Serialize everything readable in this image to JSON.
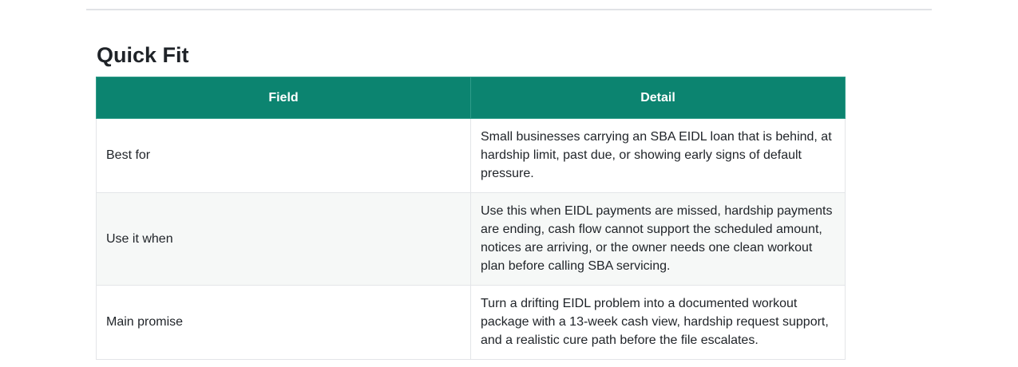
{
  "section": {
    "title": "Quick Fit"
  },
  "table": {
    "headers": [
      "Field",
      "Detail"
    ],
    "rows": [
      {
        "field": "Best for",
        "detail": "Small businesses carrying an SBA EIDL loan that is behind, at hardship limit, past due, or showing early signs of default pressure."
      },
      {
        "field": "Use it when",
        "detail": "Use this when EIDL payments are missed, hardship payments are ending, cash flow cannot support the scheduled amount, notices are arriving, or the owner needs one clean workout plan before calling SBA servicing."
      },
      {
        "field": "Main promise",
        "detail": "Turn a drifting EIDL problem into a documented workout package with a 13-week cash view, hardship request support, and a realistic cure path before the file escalates."
      }
    ]
  },
  "colors": {
    "header_bg": "#0c8470",
    "header_text": "#ffffff",
    "row_alt_bg": "#f6f8f7",
    "border": "#e3e5e8"
  }
}
